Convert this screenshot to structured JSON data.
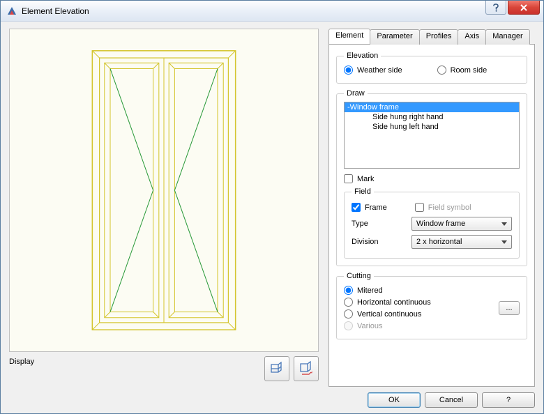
{
  "window": {
    "title": "Element Elevation"
  },
  "display": {
    "label": "Display"
  },
  "tabs": {
    "element": "Element",
    "parameter": "Parameter",
    "profiles": "Profiles",
    "axis": "Axis",
    "manager": "Manager"
  },
  "elevation": {
    "legend": "Elevation",
    "weather": "Weather side",
    "room": "Room side",
    "selected": "weather"
  },
  "draw": {
    "legend": "Draw",
    "items": [
      {
        "label": "-Window frame",
        "indent": 0,
        "selected": true
      },
      {
        "label": "Side hung right hand",
        "indent": 1,
        "selected": false
      },
      {
        "label": "Side hung left hand",
        "indent": 1,
        "selected": false
      }
    ],
    "mark_label": "Mark",
    "mark_checked": false,
    "field": {
      "legend": "Field",
      "frame_label": "Frame",
      "frame_checked": true,
      "symbol_label": "Field symbol",
      "symbol_checked": false,
      "type_label": "Type",
      "type_value": "Window frame",
      "division_label": "Division",
      "division_value": "2 x horizontal"
    }
  },
  "cutting": {
    "legend": "Cutting",
    "mitered": "Mitered",
    "horizontal": "Horizontal continuous",
    "vertical": "Vertical continuous",
    "various": "Various",
    "more": "...",
    "selected": "mitered"
  },
  "buttons": {
    "ok": "OK",
    "cancel": "Cancel",
    "help": "?"
  }
}
